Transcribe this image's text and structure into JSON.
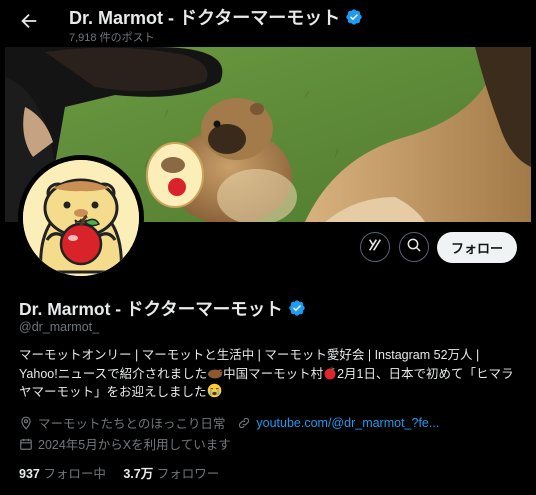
{
  "header": {
    "title": "Dr. Marmot - ドクターマーモット",
    "post_count": "7,918 件のポスト"
  },
  "profile": {
    "name": "Dr. Marmot - ドクターマーモット",
    "handle": "@dr_marmot_",
    "bio_line1": "マーモットオンリー | マーモットと生活中 | マーモット愛好会 | Instagram 52万人 |",
    "bio_line2_a": "Yahoo!ニュースで紹介されました",
    "bio_line2_b": "中国マーモット村",
    "bio_line2_c": "2月1日、日本で初めて「ヒマラ",
    "bio_line3_a": "ヤマーモット」をお迎えしました",
    "location": "マーモットたちとのほっこり日常",
    "website": "youtube.com/@dr_marmot_?fe...",
    "joined": "2024年5月からXを利用しています",
    "following_count": "937",
    "following_label": "フォロー中",
    "followers_count": "3.7万",
    "followers_label": "フォロワー"
  },
  "actions": {
    "follow_label": "フォロー"
  },
  "colors": {
    "background": "#000000",
    "verified": "#1d9bf0",
    "link": "#1d9bf0",
    "muted": "#71767b"
  },
  "icons": [
    "back-arrow-icon",
    "verified-badge-icon",
    "grok-icon",
    "search-icon",
    "location-icon",
    "link-icon",
    "calendar-icon",
    "marmot-emoji-icon",
    "apple-emoji-icon",
    "crying-face-emoji-icon"
  ]
}
